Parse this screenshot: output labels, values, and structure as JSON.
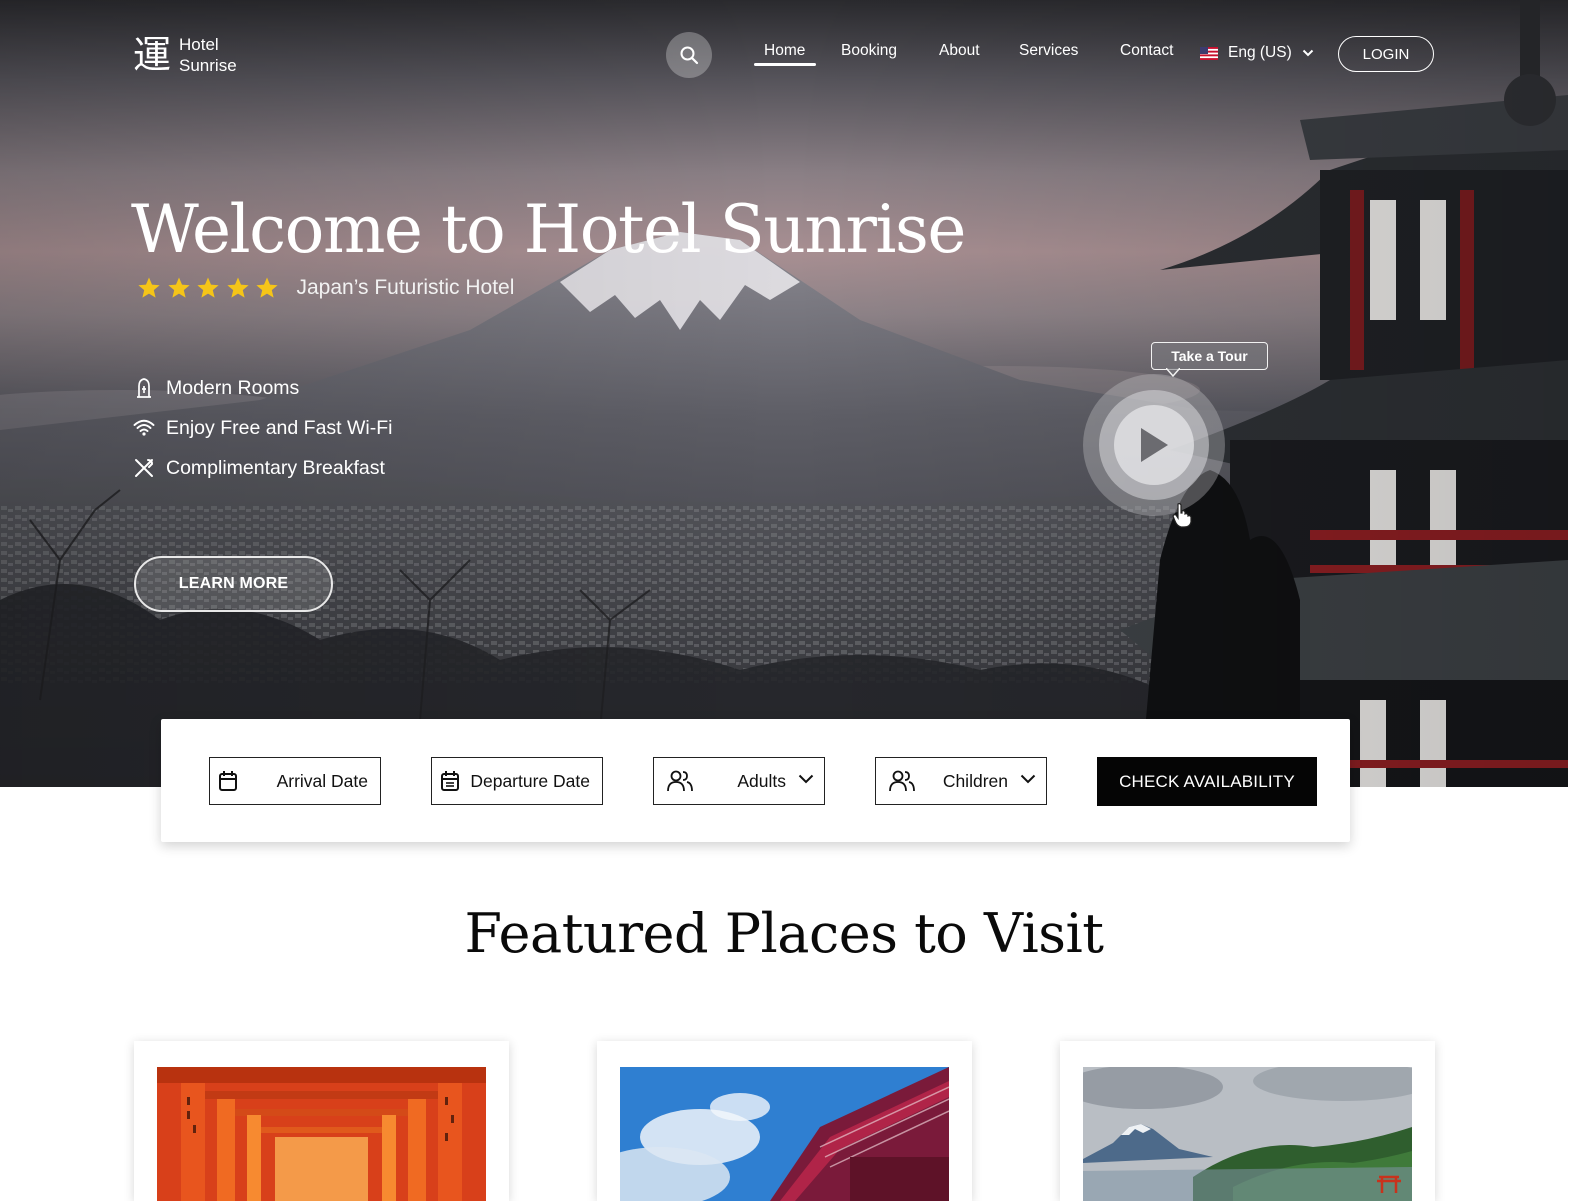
{
  "brand": {
    "mark": "運",
    "line1": "Hotel",
    "line2": "Sunrise"
  },
  "nav": {
    "items": [
      {
        "label": "Home",
        "active": true
      },
      {
        "label": "Booking",
        "active": false
      },
      {
        "label": "About",
        "active": false
      },
      {
        "label": "Services",
        "active": false
      },
      {
        "label": "Contact",
        "active": false
      }
    ],
    "language": "Eng (US)",
    "login": "LOGIN"
  },
  "hero": {
    "title": "Welcome to Hotel Sunrise",
    "rating_stars": 5,
    "tagline": "Japan’s Futuristic Hotel",
    "features": [
      {
        "icon": "room-icon",
        "label": "Modern Rooms"
      },
      {
        "icon": "wifi-icon",
        "label": "Enjoy Free and Fast Wi-Fi"
      },
      {
        "icon": "utensils-icon",
        "label": "Complimentary Breakfast"
      }
    ],
    "cta": "LEARN MORE",
    "tour_label": "Take a Tour"
  },
  "booking": {
    "arrival": "Arrival Date",
    "departure": "Departure Date",
    "adults": "Adults",
    "children": "Children",
    "submit": "CHECK AVAILABILITY"
  },
  "featured": {
    "title": "Featured Places to Visit",
    "cards": [
      {
        "image": "torii-gates-photo"
      },
      {
        "image": "red-temple-photo"
      },
      {
        "image": "mount-fuji-lake-photo"
      }
    ]
  },
  "colors": {
    "accent_star": "#f5c518",
    "button_dark": "#050505",
    "text_dark": "#0a0a0a"
  }
}
